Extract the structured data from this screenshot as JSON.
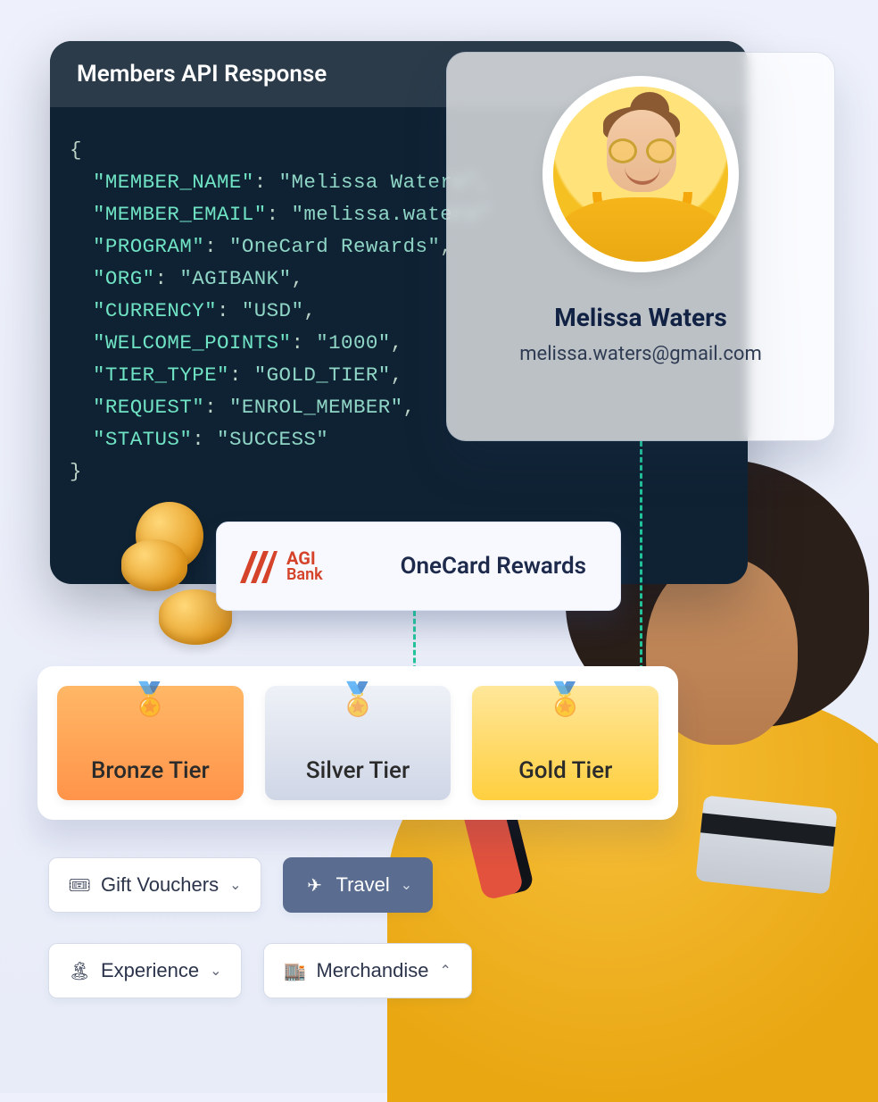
{
  "api": {
    "title": "Members API Response",
    "fields": {
      "MEMBER_NAME": "Melissa Waters",
      "MEMBER_EMAIL": "melissa.waters",
      "PROGRAM": "OneCard Rewards",
      "ORG": "AGIBANK",
      "CURRENCY": "USD",
      "WELCOME_POINTS": "1000",
      "TIER_TYPE": "GOLD_TIER",
      "REQUEST": "ENROL_MEMBER",
      "STATUS": "SUCCESS"
    }
  },
  "profile": {
    "name": "Melissa Waters",
    "email": "melissa.waters@gmail.com"
  },
  "program": {
    "bank_line1": "AGI",
    "bank_line2": "Bank",
    "name": "OneCard Rewards"
  },
  "tiers": {
    "bronze": "Bronze Tier",
    "silver": "Silver Tier",
    "gold": "Gold Tier"
  },
  "categories": {
    "gift": "Gift Vouchers",
    "travel": "Travel",
    "experience": "Experience",
    "merchandise": "Merchandise"
  }
}
